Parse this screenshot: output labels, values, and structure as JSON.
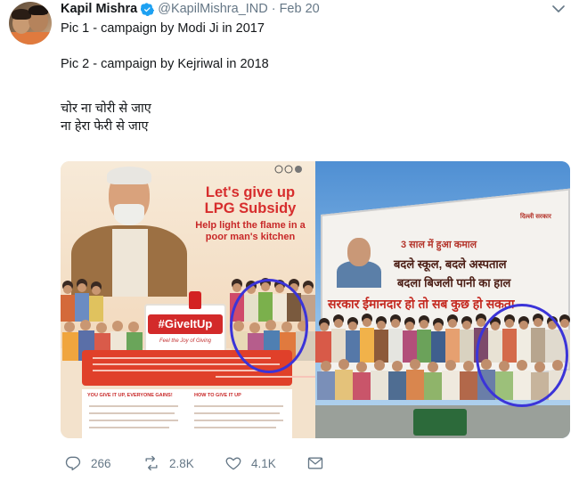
{
  "tweet": {
    "display_name": "Kapil Mishra",
    "handle": "@KapilMishra_IND",
    "separator": "·",
    "date": "Feb 20",
    "lines": [
      "Pic 1 - campaign by Modi Ji in 2017",
      "",
      "Pic 2 - campaign by Kejriwal in 2018",
      "",
      "चोर ना चोरी से जाए",
      "ना हेरा फेरी से जाए"
    ]
  },
  "media": {
    "pic1": {
      "title": "Let's give up LPG Subsidy",
      "subtitle": "Help light the flame in a poor man's kitchen",
      "hashtag": "#GiveItUp",
      "tagline": "Feel the Joy of Giving",
      "panel_left_heading": "YOU GIVE IT UP, EVERYONE GAINS!",
      "panel_right_heading": "HOW TO GIVE IT UP"
    },
    "pic2": {
      "line1": "3 साल में हुआ कमाल",
      "line2": "बदले स्कूल, बदले अस्पताल",
      "line3": "बदला बिजली पानी का हाल",
      "line4": "सरकार ईमानदार हो तो सब कुछ हो सकता",
      "logo_text": "दिल्ली सरकार"
    },
    "highlight_color": "#3b34d8"
  },
  "actions": {
    "reply_count": "266",
    "retweet_count": "2.8K",
    "like_count": "4.1K"
  },
  "icons": {
    "verified": "verified-badge-icon",
    "caret": "chevron-down-icon",
    "reply": "reply-icon",
    "retweet": "retweet-icon",
    "like": "heart-icon",
    "message": "envelope-icon"
  },
  "colors": {
    "verified": "#1da1f2",
    "secondary_text": "#657786",
    "primary_text": "#14171a"
  }
}
